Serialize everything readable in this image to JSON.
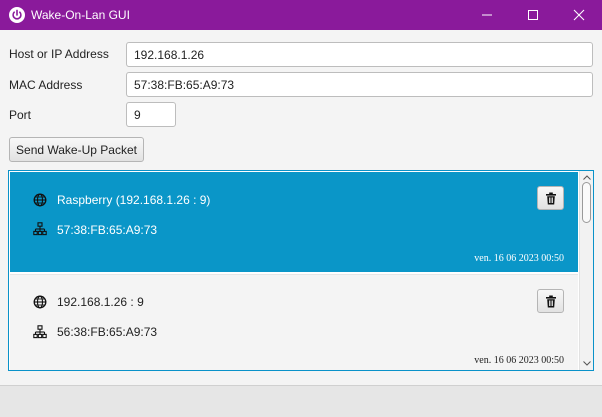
{
  "window": {
    "title": "Wake-On-Lan GUI",
    "accent_color": "#8a1a9b",
    "app_icon": "power-icon",
    "controls": [
      "minimize-icon",
      "maximize-icon",
      "close-icon"
    ]
  },
  "form": {
    "host_label": "Host or IP Address",
    "host_value": "192.168.1.26",
    "mac_label": "MAC Address",
    "mac_value": "57:38:FB:65:A9:73",
    "port_label": "Port",
    "port_value": "9",
    "send_label": "Send Wake-Up Packet"
  },
  "history": {
    "selection_color": "#0a96c8",
    "items": [
      {
        "host": "Raspberry (192.168.1.26 : 9)",
        "mac": "57:38:FB:65:A9:73",
        "date": "ven. 16 06 2023 00:50",
        "selected": true
      },
      {
        "host": "192.168.1.26 : 9",
        "mac": "56:38:FB:65:A9:73",
        "date": "ven. 16 06 2023 00:50",
        "selected": false
      }
    ]
  }
}
